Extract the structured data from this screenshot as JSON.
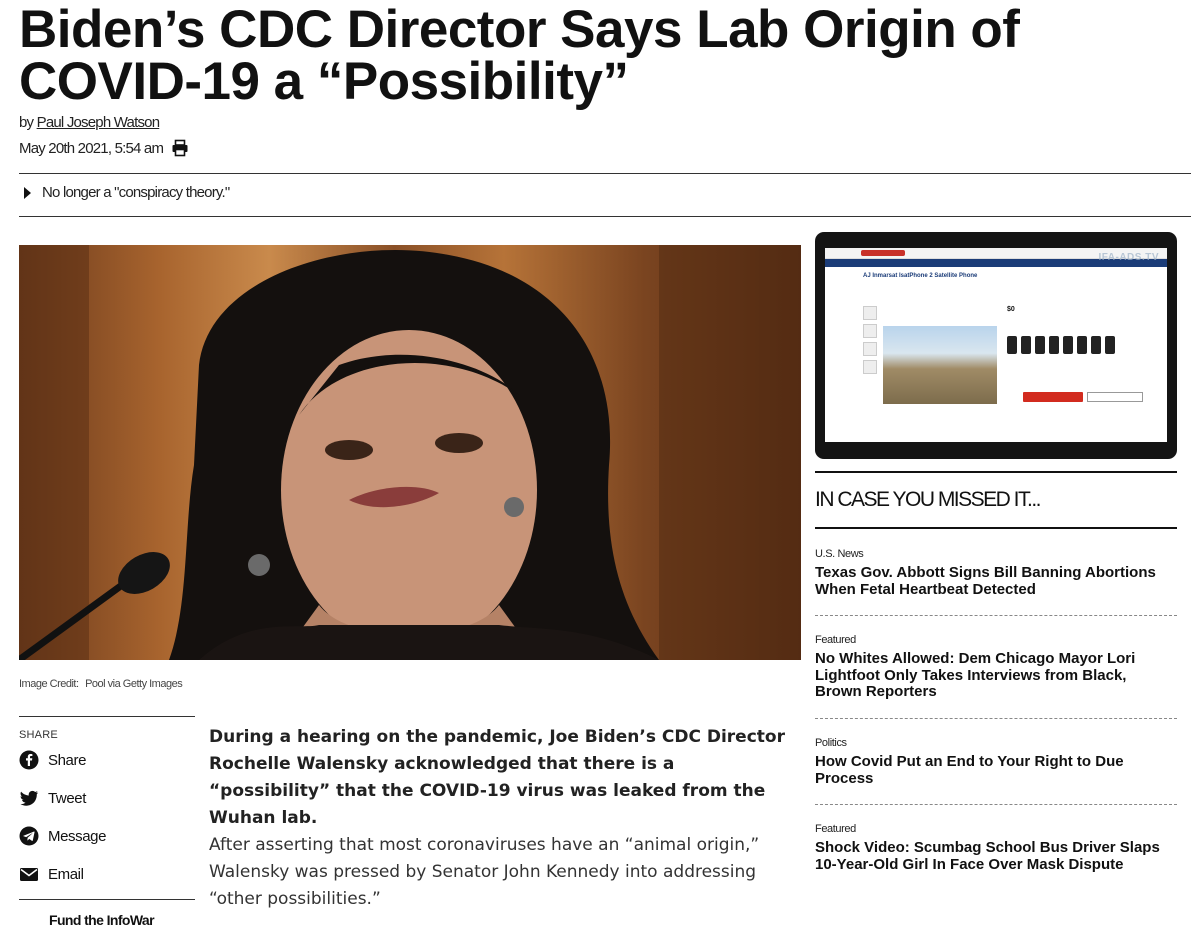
{
  "article": {
    "headline": "Biden’s CDC Director Says Lab Origin of COVID-19 a “Possibility”",
    "byline_prefix": "by",
    "author": "Paul Joseph Watson",
    "date": "May 20th 2021, 5:54 am",
    "summary": "No longer a \"conspiracy theory.\"",
    "image_credit_label": "Image Credit:",
    "image_credit": "Pool via Getty Images",
    "lead": "During a hearing on the pandemic, Joe Biden’s CDC Director Rochelle Walensky acknowledged that there is a “possibility” that the COVID-19 virus was leaked from the Wuhan lab.",
    "paragraph": "After asserting that most coronaviruses have an “animal origin,” Walensky was pressed by Senator John Kennedy into addressing “other possibilities.”"
  },
  "share": {
    "title": "SHARE",
    "items": [
      {
        "label": "Share",
        "icon": "facebook-icon"
      },
      {
        "label": "Tweet",
        "icon": "twitter-icon"
      },
      {
        "label": "Message",
        "icon": "telegram-icon"
      },
      {
        "label": "Email",
        "icon": "email-icon"
      }
    ],
    "fund_label": "Fund the InfoWar"
  },
  "ad": {
    "product_title": "AJ Inmarsat IsatPhone 2 Satellite Phone",
    "price": "$0",
    "watermark": "IFA-ADS.TV"
  },
  "sidebar": {
    "section_title": "IN CASE YOU MISSED IT...",
    "stories": [
      {
        "category": "U.S. News",
        "title": "Texas Gov. Abbott Signs Bill Banning Abortions When Fetal Heartbeat Detected"
      },
      {
        "category": "Featured",
        "title": "No Whites Allowed: Dem Chicago Mayor Lori Lightfoot Only Takes Interviews from Black, Brown Reporters"
      },
      {
        "category": "Politics",
        "title": "How Covid Put an End to Your Right to Due Process"
      },
      {
        "category": "Featured",
        "title": "Shock Video: Scumbag School Bus Driver Slaps 10-Year-Old Girl In Face Over Mask Dispute"
      }
    ]
  }
}
